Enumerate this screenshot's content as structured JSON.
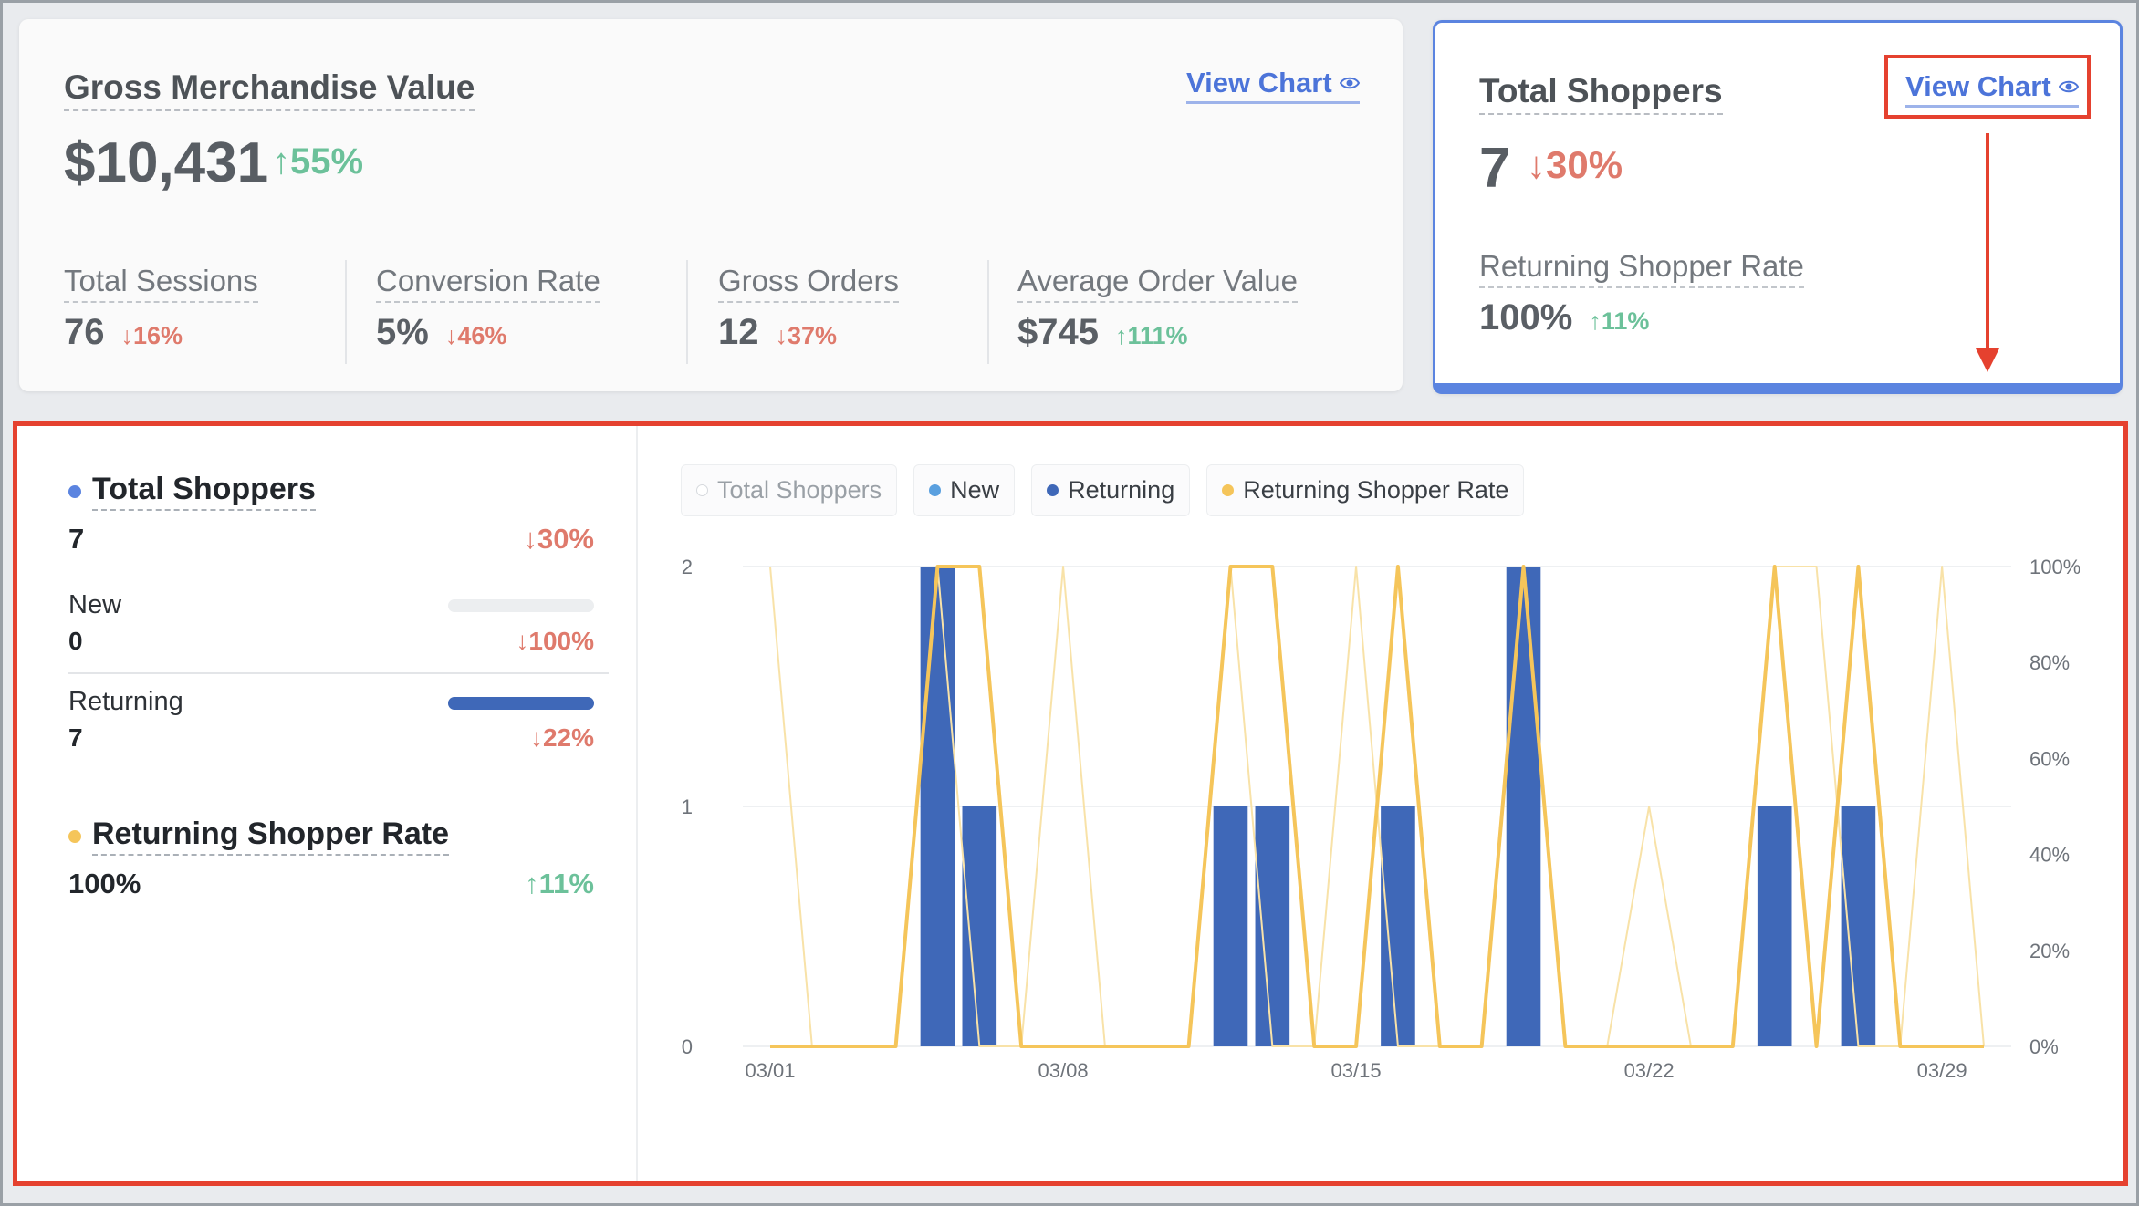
{
  "gmv_card": {
    "title": "Gross Merchandise Value",
    "view_chart_label": "View Chart",
    "value": "$10,431",
    "delta": "↑55%",
    "metrics": [
      {
        "label": "Total Sessions",
        "value": "76",
        "delta": "↓16%",
        "direction": "down"
      },
      {
        "label": "Conversion Rate",
        "value": "5%",
        "delta": "↓46%",
        "direction": "down"
      },
      {
        "label": "Gross Orders",
        "value": "12",
        "delta": "↓37%",
        "direction": "down"
      },
      {
        "label": "Average Order Value",
        "value": "$745",
        "delta": "↑111%",
        "direction": "up"
      }
    ]
  },
  "shoppers_card": {
    "title": "Total Shoppers",
    "view_chart_label": "View Chart",
    "value": "7",
    "delta": "↓30%",
    "sub_label": "Returning Shopper Rate",
    "sub_value": "100%",
    "sub_delta": "↑11%"
  },
  "detail_panel": {
    "total_shoppers": {
      "title": "Total Shoppers",
      "value": "7",
      "delta": "↓30%"
    },
    "new": {
      "label": "New",
      "value": "0",
      "delta": "↓100%",
      "share": 0
    },
    "returning": {
      "label": "Returning",
      "value": "7",
      "delta": "↓22%",
      "share": 1
    },
    "returning_rate": {
      "title": "Returning Shopper Rate",
      "value": "100%",
      "delta": "↑11%"
    },
    "legend": [
      {
        "label": "Total Shoppers",
        "color": "#ffffff",
        "active": false
      },
      {
        "label": "New",
        "color": "#5aa0df",
        "active": true
      },
      {
        "label": "Returning",
        "color": "#3f68b8",
        "active": true
      },
      {
        "label": "Returning Shopper Rate",
        "color": "#f5c55a",
        "active": true
      }
    ]
  },
  "colors": {
    "accent": "#4c74d9",
    "up": "#6cc19a",
    "down": "#df7a6c",
    "highlight": "#e5412f",
    "returning": "#3f68b8",
    "rate": "#f5c55a",
    "total_dot": "#5b84e0"
  },
  "chart_data": {
    "type": "bar",
    "x": [
      "03/01",
      "03/02",
      "03/03",
      "03/04",
      "03/05",
      "03/06",
      "03/07",
      "03/08",
      "03/09",
      "03/10",
      "03/11",
      "03/12",
      "03/13",
      "03/14",
      "03/15",
      "03/16",
      "03/17",
      "03/18",
      "03/19",
      "03/20",
      "03/21",
      "03/22",
      "03/23",
      "03/24",
      "03/25",
      "03/26",
      "03/27",
      "03/28",
      "03/29",
      "03/30"
    ],
    "x_tick_labels": [
      "03/01",
      "03/08",
      "03/15",
      "03/22",
      "03/29"
    ],
    "y_left_ticks": [
      "0",
      "1",
      "2"
    ],
    "y_right_ticks": [
      "0%",
      "20%",
      "40%",
      "60%",
      "80%",
      "100%"
    ],
    "ylim_left": [
      0,
      2
    ],
    "ylim_right": [
      0,
      100
    ],
    "series": [
      {
        "name": "Returning",
        "kind": "bar",
        "axis": "left",
        "values": [
          0,
          0,
          0,
          0,
          2,
          1,
          0,
          0,
          0,
          0,
          0,
          1,
          1,
          0,
          0,
          1,
          0,
          0,
          2,
          0,
          0,
          0,
          0,
          0,
          1,
          0,
          1,
          0,
          0,
          0
        ]
      },
      {
        "name": "New",
        "kind": "bar",
        "axis": "left",
        "values": [
          0,
          0,
          0,
          0,
          0,
          0,
          0,
          0,
          0,
          0,
          0,
          0,
          0,
          0,
          0,
          0,
          0,
          0,
          0,
          0,
          0,
          0,
          0,
          0,
          0,
          0,
          0,
          0,
          0,
          0
        ]
      },
      {
        "name": "Returning Shopper Rate",
        "kind": "line",
        "axis": "right",
        "values": [
          0,
          0,
          0,
          0,
          100,
          100,
          0,
          0,
          0,
          0,
          0,
          100,
          100,
          0,
          0,
          100,
          0,
          0,
          100,
          0,
          0,
          0,
          0,
          0,
          100,
          0,
          100,
          0,
          0,
          0
        ]
      },
      {
        "name": "Returning Shopper Rate (previous period)",
        "kind": "line",
        "axis": "right",
        "faded": true,
        "values": [
          100,
          0,
          0,
          0,
          100,
          0,
          0,
          100,
          0,
          0,
          0,
          100,
          0,
          0,
          100,
          0,
          0,
          0,
          100,
          0,
          0,
          50,
          0,
          0,
          100,
          100,
          0,
          0,
          100,
          0
        ]
      }
    ],
    "grid": true,
    "legend_position": "top-left"
  }
}
